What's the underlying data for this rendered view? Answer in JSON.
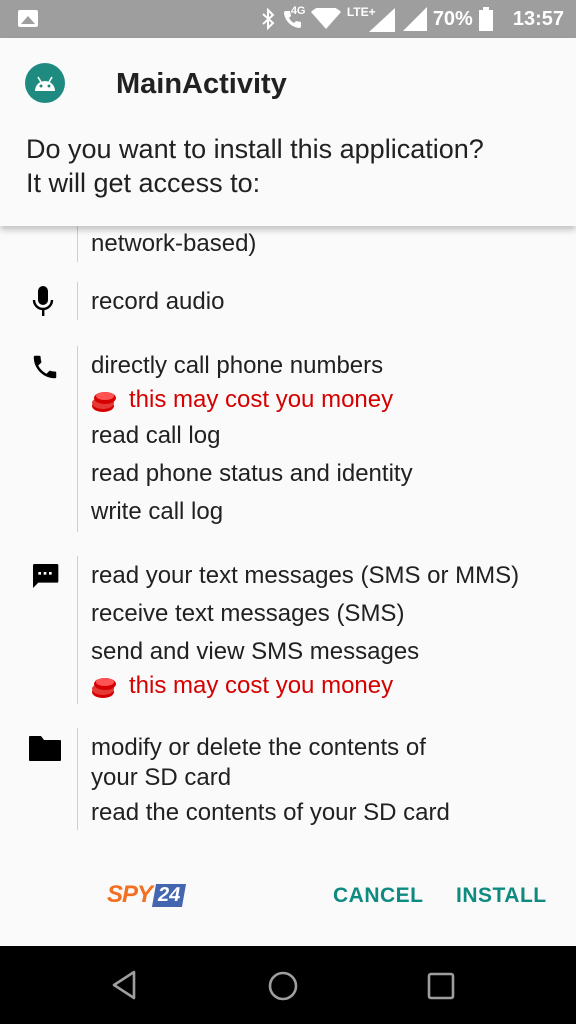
{
  "status_bar": {
    "network_label": "4G",
    "lte_label": "LTE+",
    "battery": "70%",
    "time": "13:57"
  },
  "header": {
    "app_title": "MainActivity",
    "prompt_line1": "Do you want to install this application?",
    "prompt_line2": "It will get access to:"
  },
  "permissions": {
    "location": {
      "icon": "location-icon",
      "items": [
        "network-based)"
      ]
    },
    "microphone": {
      "icon": "microphone-icon",
      "items": [
        "record audio"
      ]
    },
    "phone": {
      "icon": "phone-icon",
      "item1": "directly call phone numbers",
      "warning": "this may cost you money",
      "item2": "read call log",
      "item3": "read phone status and identity",
      "item4": "write call log"
    },
    "sms": {
      "icon": "message-icon",
      "item1": "read your text messages (SMS or MMS)",
      "item2": "receive text messages (SMS)",
      "item3": "send and view SMS messages",
      "warning": "this may cost you money"
    },
    "storage": {
      "icon": "folder-icon",
      "item1_line1": "modify or delete the contents of",
      "item1_line2": "your SD card",
      "item2": "read the contents of your SD card"
    }
  },
  "logo": {
    "part1": "SPY",
    "part2": "24"
  },
  "actions": {
    "cancel": "CANCEL",
    "install": "INSTALL"
  },
  "colors": {
    "accent": "#0f8a80",
    "warning": "#d50000",
    "app_icon": "#1e8a80"
  }
}
